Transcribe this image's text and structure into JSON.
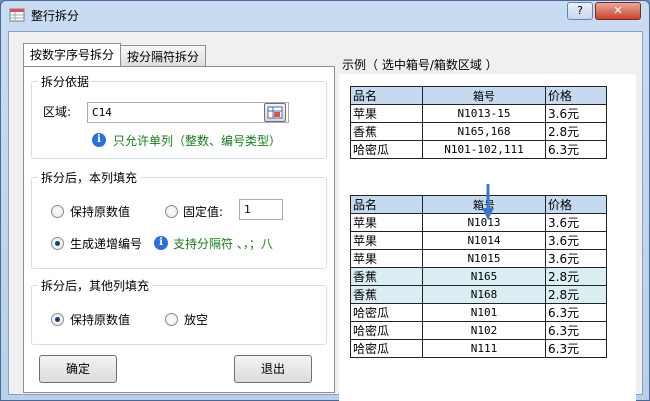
{
  "window": {
    "title": "整行拆分",
    "help_label": "?",
    "close_label": "✕"
  },
  "tabs": [
    {
      "label": "按数字序号拆分",
      "active": true
    },
    {
      "label": "按分隔符拆分",
      "active": false
    }
  ],
  "split_basis": {
    "legend": "拆分依据",
    "range_label": "区域:",
    "range_value": "C14",
    "hint": "只允许单列（整数、编号类型）"
  },
  "fill_current": {
    "legend": "拆分后，本列填充",
    "keep_original_label": "保持原数值",
    "fixed_value_label": "固定值:",
    "fixed_value": "1",
    "increment_label": "生成递增编号",
    "increment_hint": "支持分隔符 、，；八"
  },
  "fill_other": {
    "legend": "拆分后，其他列填充",
    "keep_original_label": "保持原数值",
    "empty_label": "放空"
  },
  "buttons": {
    "ok_label": "确定",
    "exit_label": "退出"
  },
  "example": {
    "title": "示例（ 选中箱号/箱数区域 ）",
    "headers": [
      "品名",
      "箱号",
      "价格"
    ],
    "before_rows": [
      [
        "苹果",
        "N1013-15",
        "3.6元"
      ],
      [
        "香蕉",
        "N165,168",
        "2.8元"
      ],
      [
        "哈密瓜",
        "N101-102,111",
        "6.3元"
      ]
    ],
    "after_rows": [
      [
        "苹果",
        "N1013",
        "3.6元"
      ],
      [
        "苹果",
        "N1014",
        "3.6元"
      ],
      [
        "苹果",
        "N1015",
        "3.6元"
      ],
      [
        "香蕉",
        "N165",
        "2.8元"
      ],
      [
        "香蕉",
        "N168",
        "2.8元"
      ],
      [
        "哈密瓜",
        "N101",
        "6.3元"
      ],
      [
        "哈密瓜",
        "N102",
        "6.3元"
      ],
      [
        "哈密瓜",
        "N111",
        "6.3元"
      ]
    ],
    "highlight_after_rows": [
      3,
      4
    ]
  },
  "colors": {
    "header_fill": "#c5d9f1",
    "highlight_fill": "#dbeef3",
    "hint_green": "#1d7a1d",
    "info_blue": "#2f6fd6",
    "arrow_blue": "#3b78bf"
  }
}
